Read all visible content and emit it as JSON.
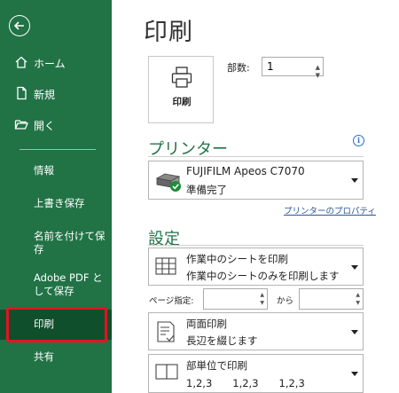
{
  "sidebar": {
    "back_label": "",
    "items": [
      {
        "label": "ホーム",
        "icon": "home-icon"
      },
      {
        "label": "新規",
        "icon": "new-document-icon"
      },
      {
        "label": "開く",
        "icon": "folder-open-icon"
      }
    ],
    "sub_items": [
      {
        "label": "情報"
      },
      {
        "label": "上書き保存"
      },
      {
        "label": "名前を付けて保存"
      },
      {
        "label": "Adobe PDF として保存"
      },
      {
        "label": "印刷"
      },
      {
        "label": "共有"
      }
    ],
    "colors": {
      "background": "#217346",
      "selected": "#0f4f2b",
      "highlight": "#e81123"
    }
  },
  "main": {
    "title": "印刷",
    "print_button_label": "印刷",
    "copies_label": "部数:",
    "copies_value": "1",
    "printer_heading": "プリンター",
    "printer": {
      "name": "FUJIFILM Apeos C7070",
      "status": "準備完了"
    },
    "printer_properties_link": "プリンターのプロパティ",
    "settings_heading": "設定",
    "settings": [
      {
        "line1": "作業中のシートを印刷",
        "line2": "作業中のシートのみを印刷します",
        "icon": "sheet-grid-icon"
      },
      {
        "line1": "両面印刷",
        "line2": "長辺を綴じます",
        "icon": "duplex-print-icon"
      },
      {
        "line1": "部単位で印刷",
        "line2": "1,2,3　　1,2,3　　1,2,3",
        "icon": "collate-icon"
      }
    ],
    "pages_label": "ページ指定:",
    "pages_from": "",
    "pages_to_label": "から",
    "pages_to": "",
    "accent_color": "#217346"
  }
}
